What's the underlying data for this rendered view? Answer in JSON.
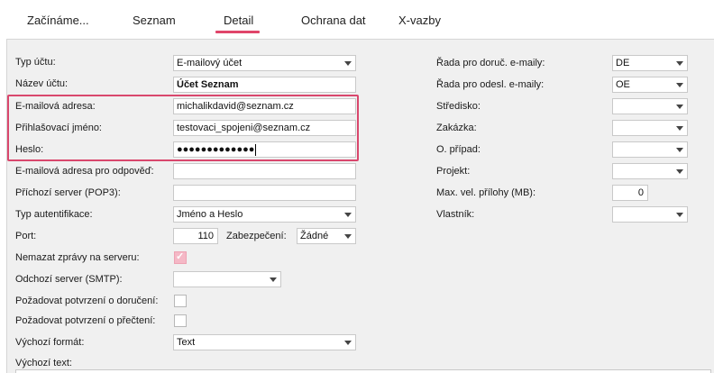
{
  "tabs": [
    {
      "label": "Začínáme..."
    },
    {
      "label": "Seznam"
    },
    {
      "label": "Detail"
    },
    {
      "label": "Ochrana dat"
    },
    {
      "label": "X-vazby"
    }
  ],
  "form_left": {
    "typ_uctu": {
      "label": "Typ účtu:",
      "value": "E-mailový účet"
    },
    "nazev_uctu": {
      "label": "Název účtu:",
      "value": "Účet Seznam"
    },
    "email_adresa": {
      "label": "E-mailová adresa:",
      "value": "michalikdavid@seznam.cz"
    },
    "prihlasovaci_jmeno": {
      "label": "Přihlašovací jméno:",
      "value": "testovaci_spojeni@seznam.cz"
    },
    "heslo": {
      "label": "Heslo:",
      "value": "●●●●●●●●●●●●●"
    },
    "odpoved_adresa": {
      "label": "E-mailová adresa pro odpověď:",
      "value": ""
    },
    "prichozi_server": {
      "label": "Příchozí server (POP3):",
      "value": ""
    },
    "typ_autentifikace": {
      "label": "Typ autentifikace:",
      "value": "Jméno a Heslo"
    },
    "port": {
      "label": "Port:",
      "value": "110"
    },
    "zabezpeceni": {
      "label": "Zabezpečení:",
      "value": "Žádné"
    },
    "nemazat": {
      "label": "Nemazat zprávy na serveru:",
      "checked": true
    },
    "odchozi_server": {
      "label": "Odchozí server (SMTP):",
      "value": ""
    },
    "potvrzeni_doruceni": {
      "label": "Požadovat potvrzení o doručení:",
      "checked": false
    },
    "potvrzeni_precteni": {
      "label": "Požadovat potvrzení o přečtení:",
      "checked": false
    },
    "vychozi_format": {
      "label": "Výchozí formát:",
      "value": "Text"
    },
    "vychozi_text": {
      "label": "Výchozí text:"
    }
  },
  "form_right": {
    "rada_doruc": {
      "label": "Řada pro doruč. e-maily:",
      "value": "DE"
    },
    "rada_odesl": {
      "label": "Řada pro odesl. e-maily:",
      "value": "OE"
    },
    "stredisko": {
      "label": "Středisko:",
      "value": ""
    },
    "zakazka": {
      "label": "Zakázka:",
      "value": ""
    },
    "o_pripad": {
      "label": "O. případ:",
      "value": ""
    },
    "projekt": {
      "label": "Projekt:",
      "value": ""
    },
    "max_priloha": {
      "label": "Max. vel. přílohy (MB):",
      "value": "0"
    },
    "vlastnik": {
      "label": "Vlastník:",
      "value": ""
    }
  },
  "colors": {
    "accent": "#e0456a",
    "highlight": "#d9476d",
    "panel": "#f0f0f0"
  }
}
